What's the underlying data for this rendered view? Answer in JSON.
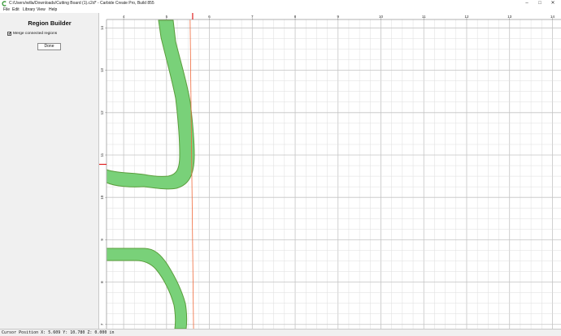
{
  "window": {
    "title": "C:/Users/willa/Downloads/Cutting Board (1).c2d* - Carbide Create Pro, Build 855",
    "minimize_glyph": "–",
    "maximize_glyph": "□",
    "close_glyph": "✕",
    "app_icon": "carbide-create-icon"
  },
  "menu": [
    "File",
    "Edit",
    "Library",
    "View",
    "Help"
  ],
  "panel": {
    "title": "Region Builder",
    "merge_label": "Merge connected regions",
    "merge_checked": true,
    "check_glyph": "✔",
    "done_label": "Done"
  },
  "canvas": {
    "x_range": [
      3.6,
      14.2
    ],
    "y_range": [
      6.9,
      14.2
    ],
    "x_ticks": [
      "4",
      "5",
      "6",
      "7",
      "8",
      "9",
      "10",
      "11",
      "12",
      "13",
      "14"
    ],
    "y_ticks": [
      "7",
      "8",
      "9",
      "10",
      "11",
      "12",
      "13",
      "14"
    ],
    "cursor_x": 5.609,
    "cursor_y": 10.78,
    "vector_color": "#79d179",
    "vector_outline": "#5a9e3c",
    "guide_color": "#f06a3c",
    "grid_color": "#dedede",
    "grid_major_color": "#c4c4c4"
  },
  "status": {
    "text": "Cursor Position X: 5.609 Y: 10.780 Z: 0.000 in"
  }
}
